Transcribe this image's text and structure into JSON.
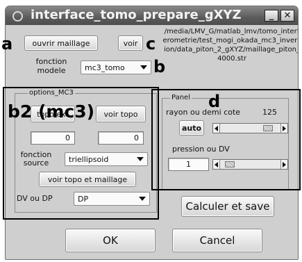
{
  "window": {
    "title": "interface_tomo_prepare_gXYZ",
    "minimize_label": "_",
    "close_label": "✕"
  },
  "top": {
    "open_mesh_button": "ouvrir maillage",
    "view_button": "voir",
    "model_function_label": "fonction\nmodele",
    "model_function_value": "mc3_tomo",
    "file_path": "/media/LMV_G/matlab_lmv/tomo_interferometrie/test_mogi_okada_mc3_inversion/data_piton_2_gXYZ/maillage_piton_4000.str"
  },
  "options_mc3": {
    "group_title": "options_MC3",
    "topo_button": "topo ext",
    "view_topo_button": "voir topo",
    "value_left": "0",
    "value_right": "0",
    "source_function_label": "fonction\nsource",
    "source_function_value": "triellipsoid",
    "view_topo_mesh_button": "voir topo et maillage",
    "dv_dp_label": "DV ou DP",
    "dv_dp_value": "DP"
  },
  "panel": {
    "group_title": "Panel",
    "radius_label": "rayon ou demi cote",
    "radius_value": "125",
    "auto_button": "auto",
    "radius_slider_fraction": 0.85,
    "pressure_label": "pression ou DV",
    "pressure_value": "1",
    "pressure_slider_fraction": 0.1
  },
  "actions": {
    "calc_save_button": "Calculer et save",
    "ok_button": "OK",
    "cancel_button": "Cancel"
  },
  "annotations": {
    "a": "a",
    "b": "b",
    "c": "c",
    "d": "d",
    "b2": "b2 (mc3)"
  },
  "colors": {
    "window_bg": "#cfcfcf",
    "titlebar": "#5b5b5b",
    "annotation": "#000000"
  }
}
